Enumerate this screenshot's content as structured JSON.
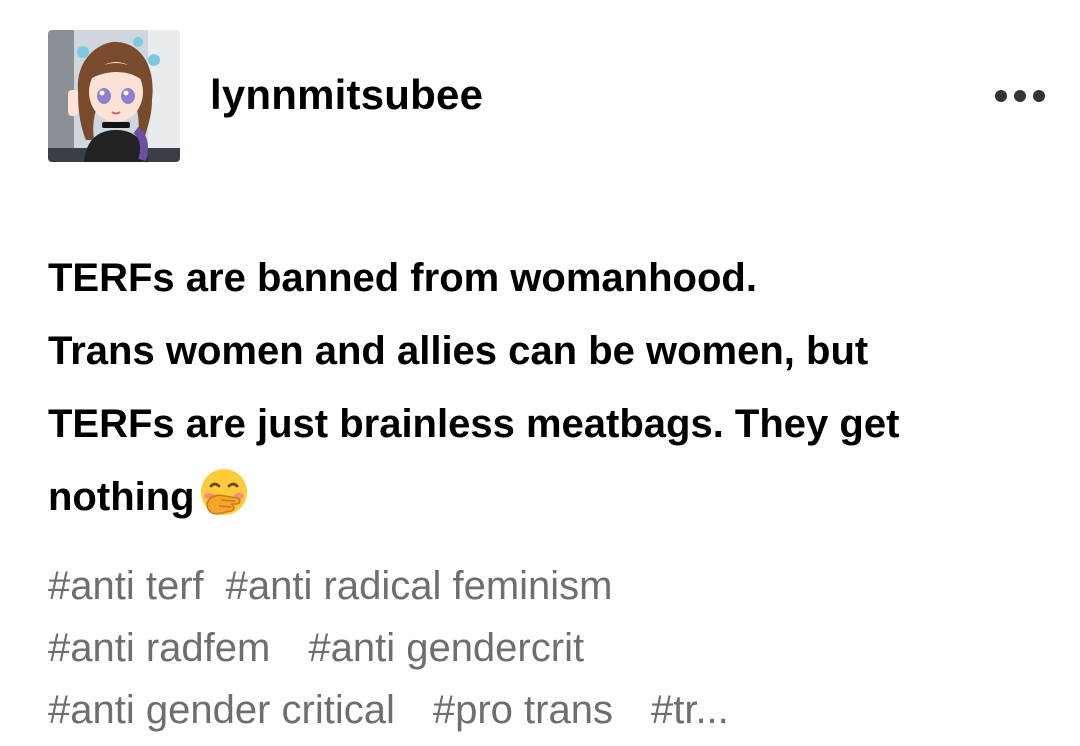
{
  "post": {
    "username": "lynnmitsubee",
    "avatar_icon": "avatar-anime-girl-icon",
    "more_icon": "more-options-icon",
    "body_lines": [
      "TERFs are banned from womanhood.",
      "Trans women and allies can be women, but",
      "TERFs are just brainless meatbags. They get",
      "nothing"
    ],
    "emoji_name": "face-with-hand-over-mouth-emoji",
    "tag_rows": [
      [
        "#anti terf",
        "#anti radical feminism"
      ],
      [
        "#anti radfem",
        "#anti gendercrit"
      ],
      [
        "#anti gender critical",
        "#pro trans",
        "#tr..."
      ]
    ]
  },
  "colors": {
    "text": "#000000",
    "tag_text": "#6e6e6e",
    "background": "#ffffff"
  }
}
